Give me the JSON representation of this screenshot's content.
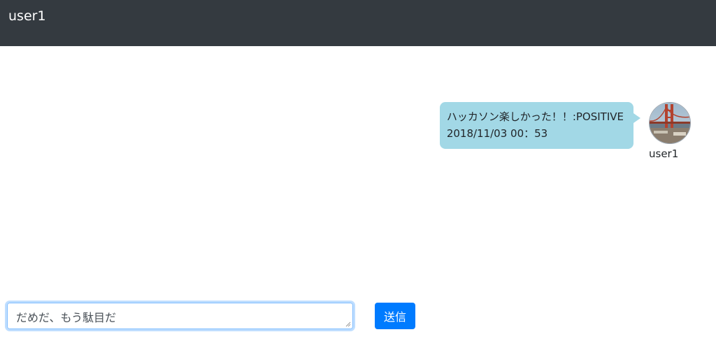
{
  "navbar": {
    "title": "user1",
    "background": "#343a40"
  },
  "messages": [
    {
      "text": "ハッカソン楽しかった！！:POSITIVE",
      "timestamp": "2018/11/03 00：53",
      "sender": "user1",
      "avatar_icon": "golden-gate-bridge-photo",
      "bubble_color": "#a2d8e6"
    }
  ],
  "composer": {
    "input_value": "だめだ、もう駄目だ",
    "send_label": "送信",
    "send_color": "#007bff"
  }
}
